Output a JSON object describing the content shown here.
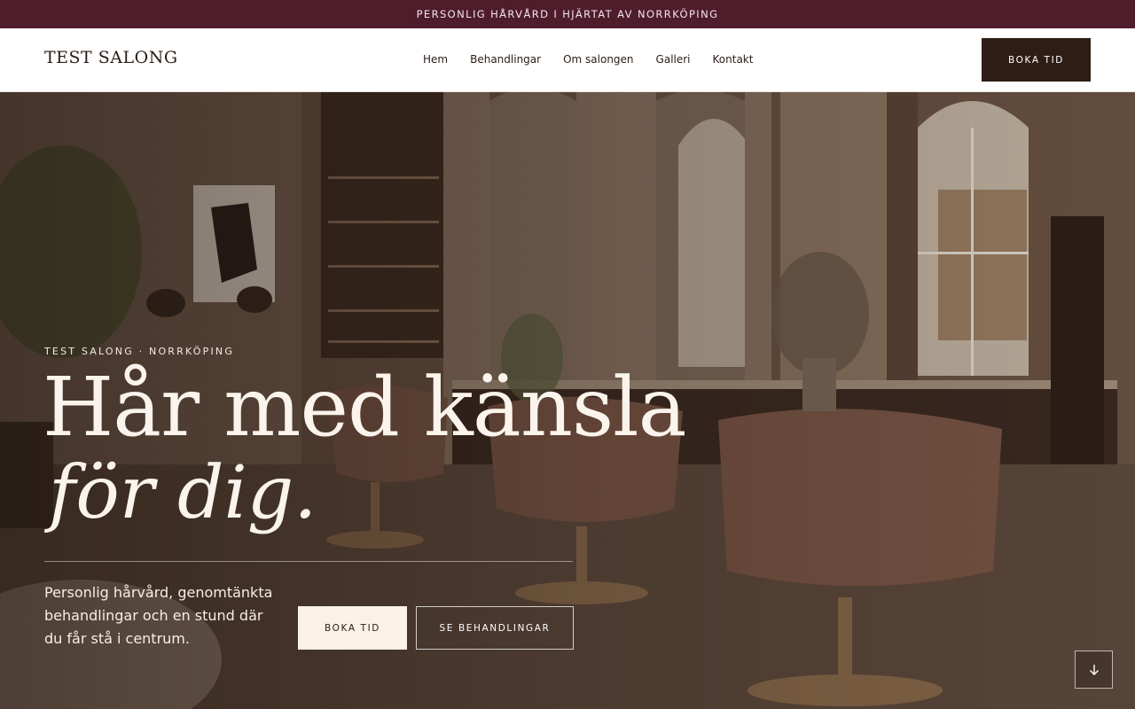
{
  "announcement": "PERSONLIG HÅRVÅRD I HJÄRTAT AV NORRKÖPING",
  "header": {
    "logo": "TEST SALONG",
    "nav": [
      "Hem",
      "Behandlingar",
      "Om salongen",
      "Galleri",
      "Kontakt"
    ],
    "cta": "BOKA TID"
  },
  "hero": {
    "eyebrow": "TEST SALONG · NORRKÖPING",
    "headline": "Hår med känsla",
    "headline_italic": "för dig.",
    "lede": "Personlig hårvård, genomtänkta behandlingar och en stund där du får stå i centrum.",
    "primary_cta": "BOKA TID",
    "secondary_cta": "SE BEHANDLINGAR",
    "scroll_icon": "arrow-down-icon"
  },
  "colors": {
    "announcement_bg": "#4f1c2c",
    "header_cta_bg": "#2e1d15",
    "primary_cta_bg": "#faf1e7"
  }
}
